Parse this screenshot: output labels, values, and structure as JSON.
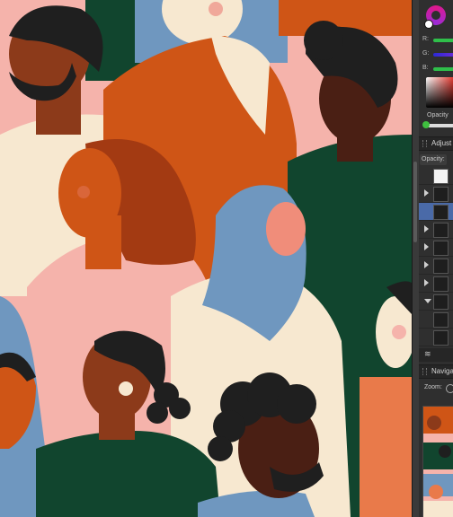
{
  "colors": {
    "pink_bg": "#f5b3ab",
    "cream": "#f7e8d0",
    "orange": "#cf5516",
    "green": "#11452e",
    "blue": "#6f97bf",
    "skin_dark": "#4a1f14",
    "skin_brown": "#8c3a1a",
    "hair": "#1f1f1f",
    "accent_magenta": "#e0188b"
  },
  "color_panel": {
    "channel_r": "R:",
    "channel_g": "G:",
    "channel_b": "B:",
    "opacity_label": "Opacity"
  },
  "layers_panel": {
    "title": "Adjust",
    "opacity_label": "Opacity:"
  },
  "navigator_panel": {
    "title": "Naviga",
    "zoom_label": "Zoom:"
  },
  "icons": [
    "color-wheel-icon",
    "swap-colors-icon",
    "panel-grip-icon",
    "expand-arrow-icon",
    "layers-stack-icon",
    "zoom-out-icon"
  ]
}
